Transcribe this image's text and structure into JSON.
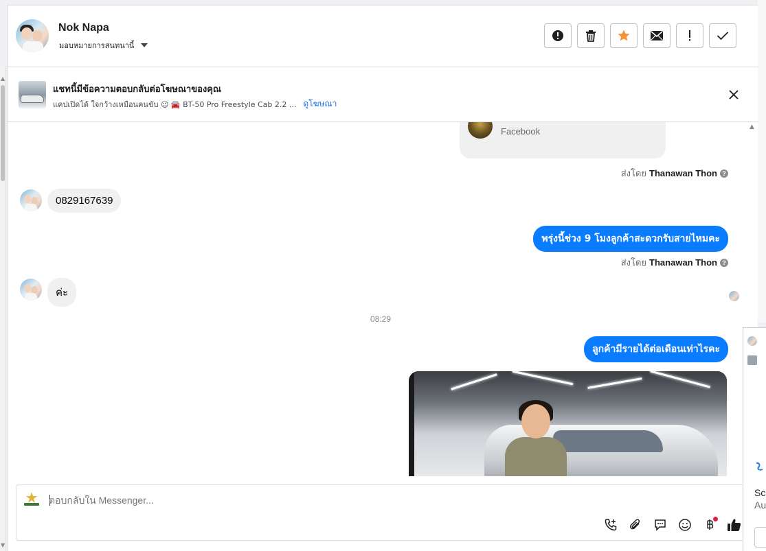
{
  "header": {
    "contact_name": "Nok Napa",
    "assign_label": "มอบหมายการสนทนานี้",
    "actions": [
      {
        "name": "report-icon",
        "label": "report"
      },
      {
        "name": "trash-icon",
        "label": "delete"
      },
      {
        "name": "star-icon",
        "label": "star"
      },
      {
        "name": "envelope-icon",
        "label": "mark unread"
      },
      {
        "name": "exclamation-icon",
        "label": "spam"
      },
      {
        "name": "check-icon",
        "label": "done"
      }
    ],
    "accent_star": "#f7923a"
  },
  "ad_banner": {
    "title": "แชทนี้มีข้อความตอบกลับต่อโฆษณาของคุณ",
    "subtitle": "แคปเปิดได้ ใจกว้างเหมือนคนขับ 😉 🚘 BT-50 Pro Freestyle Cab 2.2 ...",
    "link": "ดูโฆษณา"
  },
  "chat": {
    "share_card_source": "Facebook",
    "sent_by_prefix": "ส่งโดย",
    "sent_by_name": "Thanawan Thon",
    "messages": [
      {
        "dir": "in",
        "text": "0829167639"
      },
      {
        "dir": "out",
        "text": "พรุ่งนี้ช่วง 9 โมงลูกค้าสะดวกรับสายไหมคะ"
      },
      {
        "dir": "in",
        "text": "ค่ะ"
      },
      {
        "dir": "out",
        "text": "ลูกค้ามีรายได้ต่อเดือนเท่าไรคะ"
      }
    ],
    "timestamp": "08:29"
  },
  "composer": {
    "placeholder": "ตอบกลับใน Messenger..."
  },
  "right_strip": {
    "text1": "Scr",
    "text2": "Au"
  },
  "colors": {
    "outgoing_bubble": "#0a7cff",
    "link": "#1a6fe8"
  }
}
